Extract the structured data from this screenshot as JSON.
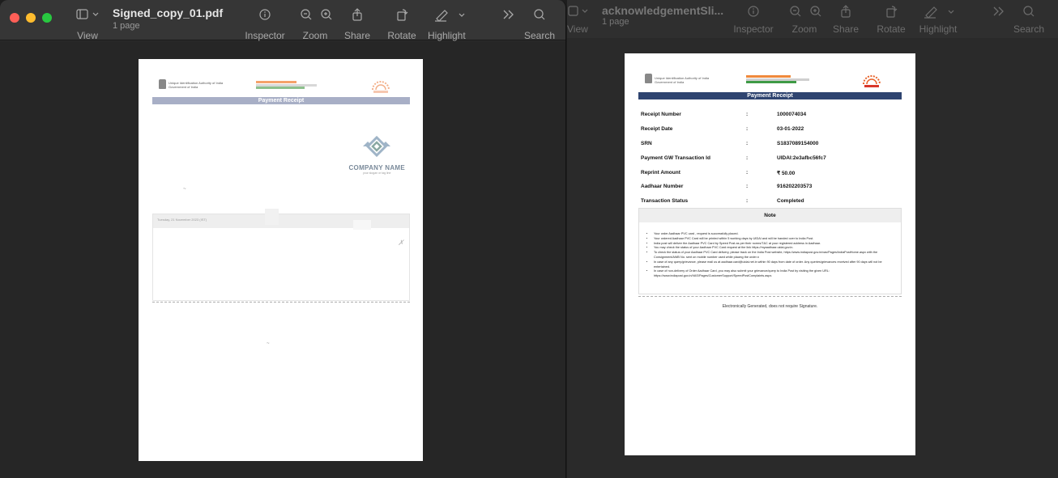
{
  "left_window": {
    "title": "Signed_copy_01.pdf",
    "subtitle": "1 page",
    "toolbar": {
      "view": "View",
      "inspector": "Inspector",
      "zoom": "Zoom",
      "share": "Share",
      "rotate": "Rotate",
      "highlight": "Highlight",
      "search": "Search"
    },
    "page": {
      "authority": "Unique Identification Authority of India",
      "govt": "Government of India",
      "receipt_title": "Payment Receipt",
      "company_name": "COMPANY NAME",
      "company_tagline": "your slogan or tag line",
      "box_header": "Tuesday, 21 November 2023 (IST)"
    }
  },
  "right_window": {
    "title": "acknowledgementSli...",
    "subtitle": "1 page",
    "toolbar": {
      "view": "View",
      "inspector": "Inspector",
      "zoom": "Zoom",
      "share": "Share",
      "rotate": "Rotate",
      "highlight": "Highlight",
      "search": "Search"
    },
    "page": {
      "authority": "Unique Identification Authority of India",
      "govt": "Government of India",
      "receipt_title": "Payment Receipt",
      "rows": [
        {
          "key": "Receipt Number",
          "sep": ":",
          "value": "1000074034"
        },
        {
          "key": "Receipt Date",
          "sep": ":",
          "value": "03-01-2022"
        },
        {
          "key": "SRN",
          "sep": ":",
          "value": "S1837089154000"
        },
        {
          "key": "Payment GW Transaction Id",
          "sep": ":",
          "value": "UIDAI:2e3afbc56fc7"
        },
        {
          "key": "Reprint Amount",
          "sep": ":",
          "value": "₹ 50.00"
        },
        {
          "key": "Aadhaar Number",
          "sep": ":",
          "value": "916202203573"
        },
        {
          "key": "Transaction Status",
          "sep": ":",
          "value": "Completed"
        }
      ],
      "note_title": "Note",
      "notes": [
        "Your order Aadhaar PVC card , request is successfully placed.",
        "Your ordered Aadhaar PVC Card will be printed within 5 working days by UIDAI and will be handed over to India Post.",
        "India post will deliver the Aadhaar PVC Card by Speed Post as per their norms/T&C at your registered address in Aadhaar.",
        "You may check the status of your Aadhaar PVC Card request at the link https://myaadhaar.uidai.gov.in.",
        "To check the status of your Aadhaar PVC Card delivery, please track on the India Post website, https://www.indiapost.gov.in/vas/Pages/IndiaPostHome.aspx with the Consignment/AWB No. sent on mobile number used while placing the order.n",
        "In case of any query/grievance, please mail us at aadhaar.card@uidai.net.in within 90 days from date of order. Any queries/grievances received after 90 days will not be entertained.",
        "In case of non-delivery of Order Aadhaar Card, you may also submit your grievance/query to India Post by visiting the given URL: https://www.indiapost.gov.in/VAS/Pages/CustomerSupport/SpeedPostComplaints.aspx."
      ],
      "footer": "Electronically Generated, does not require Signature."
    }
  },
  "colors": {
    "close": "#ff5f57",
    "minimize": "#febc2e",
    "maximize": "#28c840",
    "receipt_bar_left": "#a8afc6",
    "receipt_bar_right": "#2e4470"
  }
}
